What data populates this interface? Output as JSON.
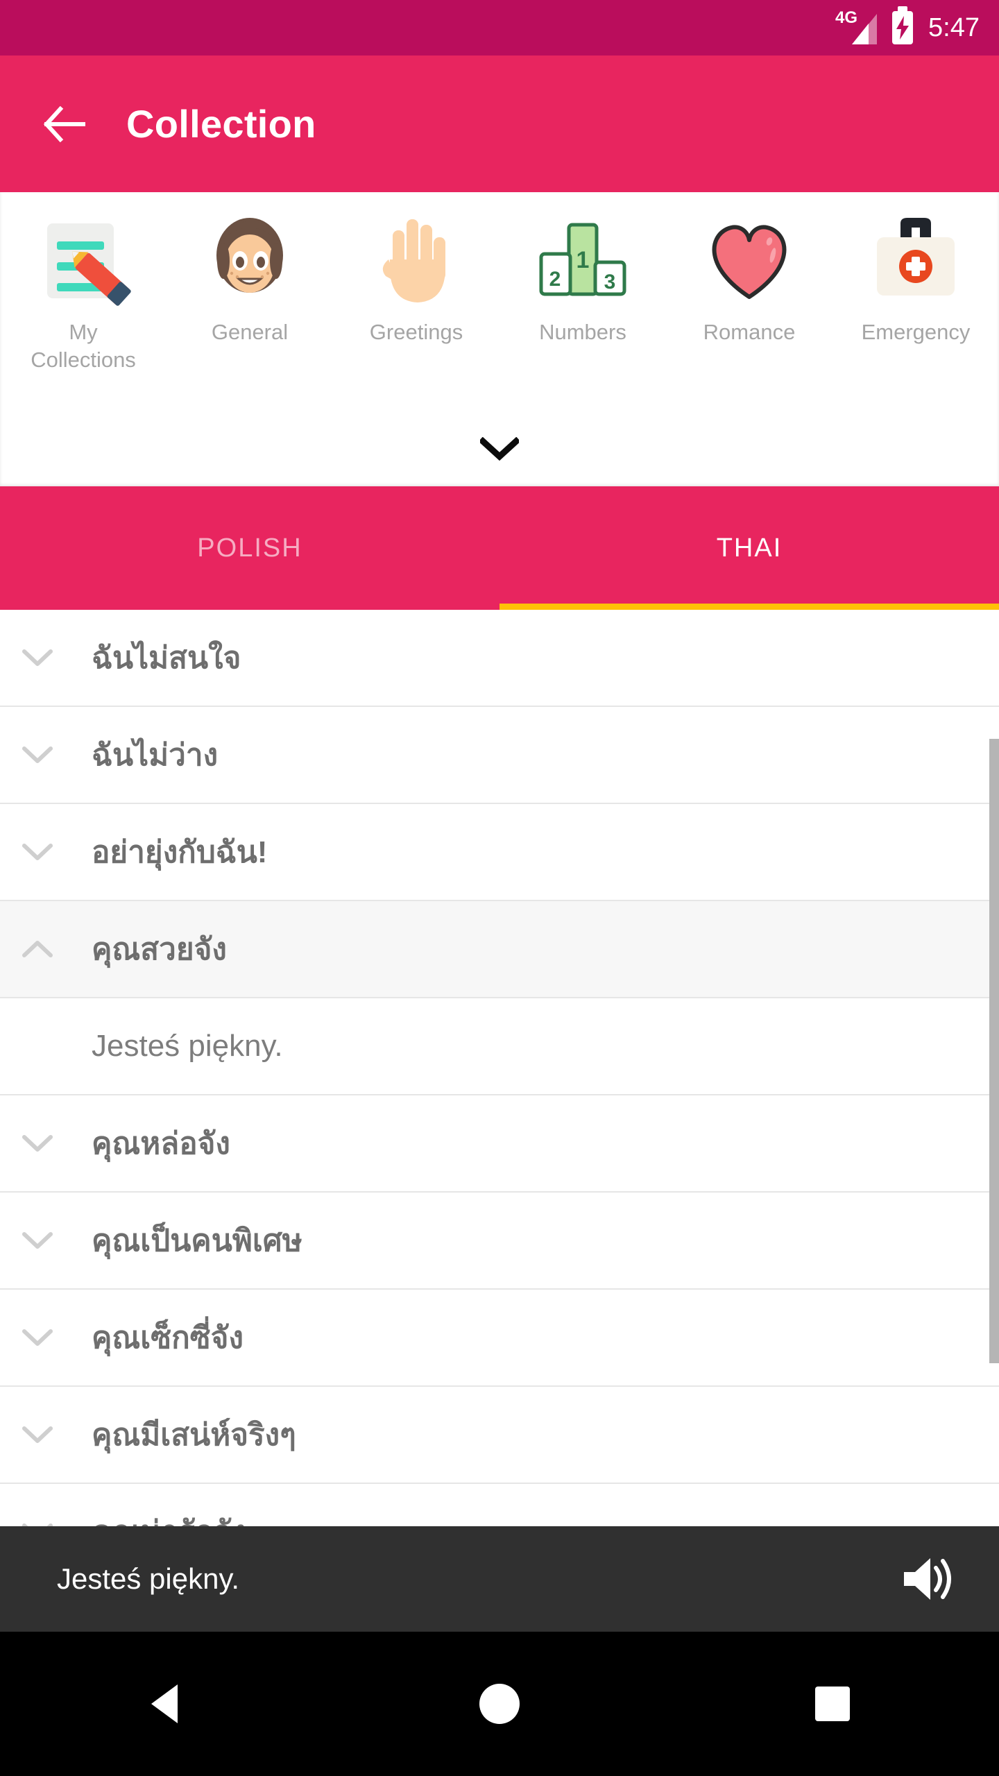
{
  "status_bar": {
    "network": "4G",
    "time": "5:47",
    "battery_icon": "battery-charging-icon",
    "signal_icon": "signal-icon"
  },
  "app_bar": {
    "back_icon": "back-arrow-icon",
    "title": "Collection",
    "background": "#e8255f"
  },
  "categories": {
    "expand_icon": "chevron-down-icon",
    "items": [
      {
        "label": "My Collections",
        "icon": "notepad-pencil-icon"
      },
      {
        "label": "General",
        "icon": "girl-face-icon"
      },
      {
        "label": "Greetings",
        "icon": "waving-hand-icon"
      },
      {
        "label": "Numbers",
        "icon": "podium-icon"
      },
      {
        "label": "Romance",
        "icon": "heart-icon"
      },
      {
        "label": "Emergency",
        "icon": "first-aid-kit-icon"
      }
    ]
  },
  "tabs": {
    "items": [
      {
        "label": "POLISH",
        "active": false
      },
      {
        "label": "THAI",
        "active": true
      }
    ],
    "indicator_color": "#ffc107"
  },
  "phrase_list": {
    "rows": [
      {
        "text": "ฉันไม่สนใจ",
        "type": "phrase",
        "expanded": false,
        "icon": "chevron-down-icon"
      },
      {
        "text": "ฉันไม่ว่าง",
        "type": "phrase",
        "expanded": false,
        "icon": "chevron-down-icon"
      },
      {
        "text": "อย่ายุ่งกับฉัน!",
        "type": "phrase",
        "expanded": false,
        "icon": "chevron-down-icon"
      },
      {
        "text": "คุณสวยจัง",
        "type": "phrase",
        "expanded": true,
        "icon": "chevron-up-icon"
      },
      {
        "text": "Jesteś piękny.",
        "type": "translation"
      },
      {
        "text": "คุณหล่อจัง",
        "type": "phrase",
        "expanded": false,
        "icon": "chevron-down-icon"
      },
      {
        "text": "คุณเป็นคนพิเศษ",
        "type": "phrase",
        "expanded": false,
        "icon": "chevron-down-icon"
      },
      {
        "text": "คุณเซ็กซี่จัง",
        "type": "phrase",
        "expanded": false,
        "icon": "chevron-down-icon"
      },
      {
        "text": "คุณมีเสน่ห์จริงๆ",
        "type": "phrase",
        "expanded": false,
        "icon": "chevron-down-icon"
      },
      {
        "text": "คุณน่ารักจัง",
        "type": "phrase",
        "expanded": false,
        "icon": "chevron-down-icon"
      }
    ]
  },
  "player_bar": {
    "text": "Jesteś piękny.",
    "speaker_icon": "speaker-volume-icon",
    "background": "#303030"
  },
  "nav_bar": {
    "back_icon": "nav-back-triangle-icon",
    "home_icon": "nav-home-circle-icon",
    "recents_icon": "nav-recents-square-icon"
  }
}
